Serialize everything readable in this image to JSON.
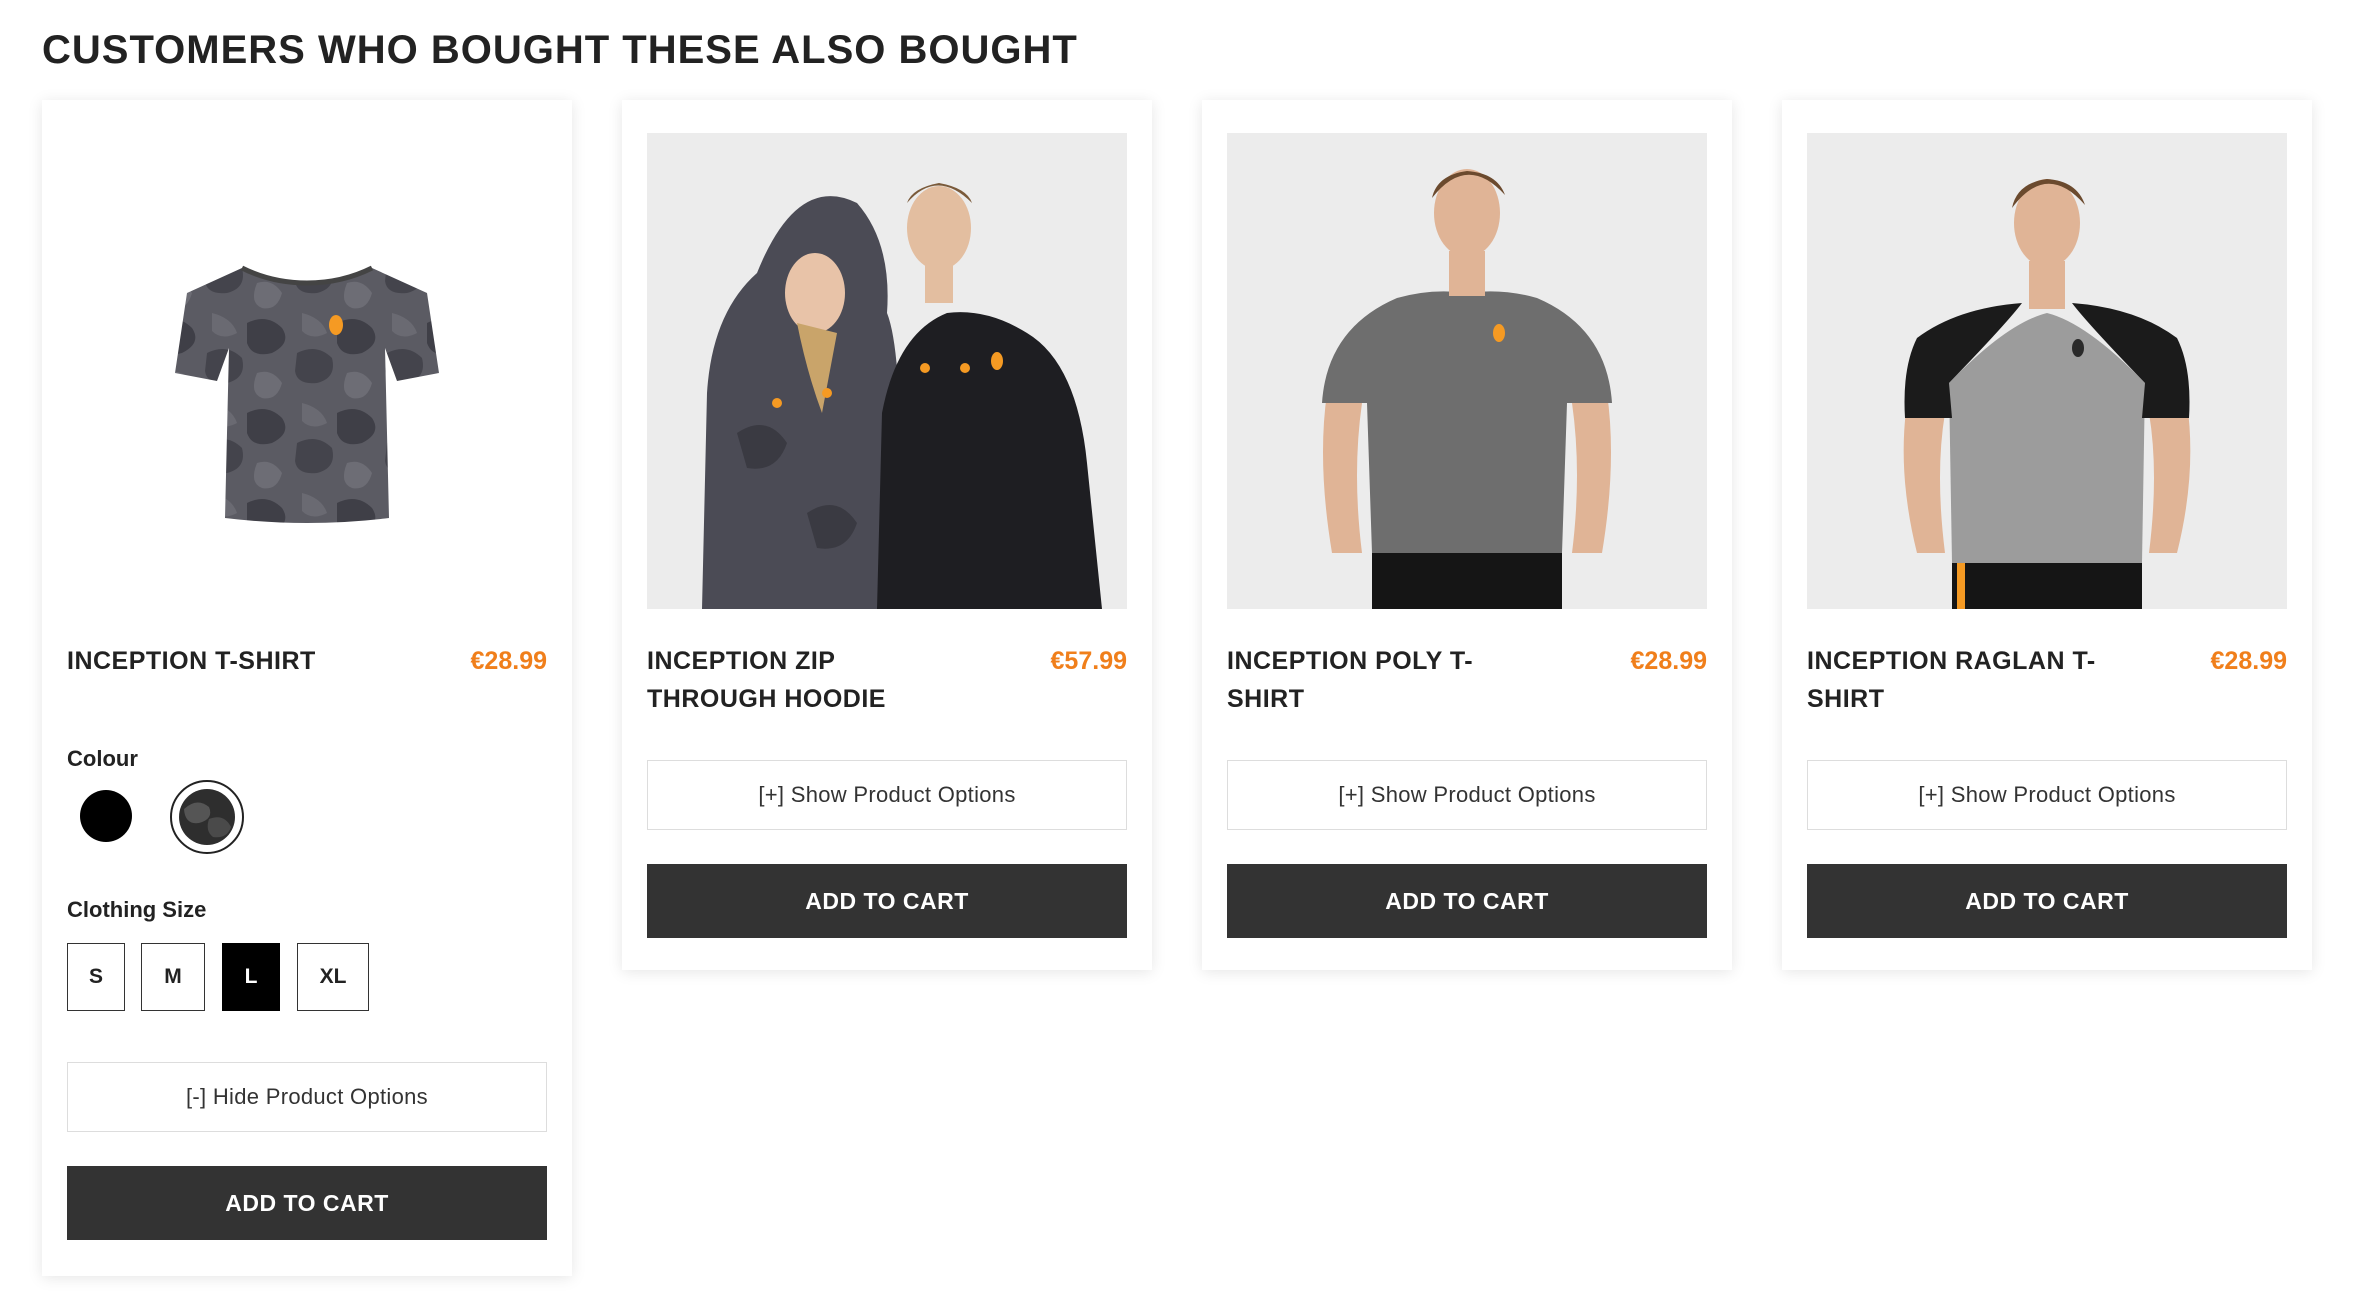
{
  "section": {
    "title": "CUSTOMERS WHO BOUGHT THESE ALSO BOUGHT"
  },
  "colors": {
    "price": "#f07f1b",
    "button_bg": "#333333",
    "accent_logo": "#f59a23"
  },
  "products": [
    {
      "name": "INCEPTION T-SHIRT",
      "price": "€28.99",
      "image_icon": "camo-tshirt-image",
      "options_expanded": true,
      "colour_label": "Colour",
      "colours": [
        "Black",
        "Dark Camo"
      ],
      "selected_colour": "Dark Camo",
      "size_label": "Clothing Size",
      "sizes": [
        "S",
        "M",
        "L",
        "XL"
      ],
      "selected_size": "L",
      "toggle_label": "[-] Hide Product Options",
      "cart_label": "ADD TO CART"
    },
    {
      "name": "INCEPTION ZIP THROUGH HOODIE",
      "price": "€57.99",
      "image_icon": "hoodie-models-image",
      "options_expanded": false,
      "toggle_label": "[+] Show Product Options",
      "cart_label": "ADD TO CART"
    },
    {
      "name": "INCEPTION POLY T-SHIRT",
      "price": "€28.99",
      "image_icon": "poly-tshirt-model-image",
      "options_expanded": false,
      "toggle_label": "[+] Show Product Options",
      "cart_label": "ADD TO CART"
    },
    {
      "name": "INCEPTION RAGLAN T-SHIRT",
      "price": "€28.99",
      "image_icon": "raglan-tshirt-model-image",
      "options_expanded": false,
      "toggle_label": "[+] Show Product Options",
      "cart_label": "ADD TO CART"
    }
  ]
}
